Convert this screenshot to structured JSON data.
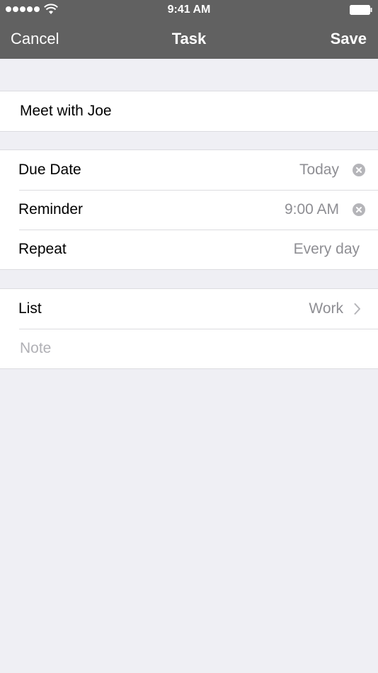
{
  "status_bar": {
    "time": "9:41 AM"
  },
  "nav": {
    "cancel": "Cancel",
    "title": "Task",
    "save": "Save"
  },
  "task": {
    "name": "Meet with Joe"
  },
  "schedule": {
    "due_date": {
      "label": "Due Date",
      "value": "Today"
    },
    "reminder": {
      "label": "Reminder",
      "value": "9:00 AM"
    },
    "repeat": {
      "label": "Repeat",
      "value": "Every day"
    }
  },
  "details": {
    "list": {
      "label": "List",
      "value": "Work"
    },
    "note_placeholder": "Note"
  },
  "icons": {
    "signal": "signal-dots-icon",
    "wifi": "wifi-icon",
    "battery": "battery-icon",
    "clear": "clear-circle-icon",
    "chevron": "chevron-right-icon"
  },
  "colors": {
    "nav_background": "#616161",
    "page_background": "#efeff4",
    "secondary_text": "#8e8e93",
    "placeholder_text": "#b0b0b5"
  }
}
